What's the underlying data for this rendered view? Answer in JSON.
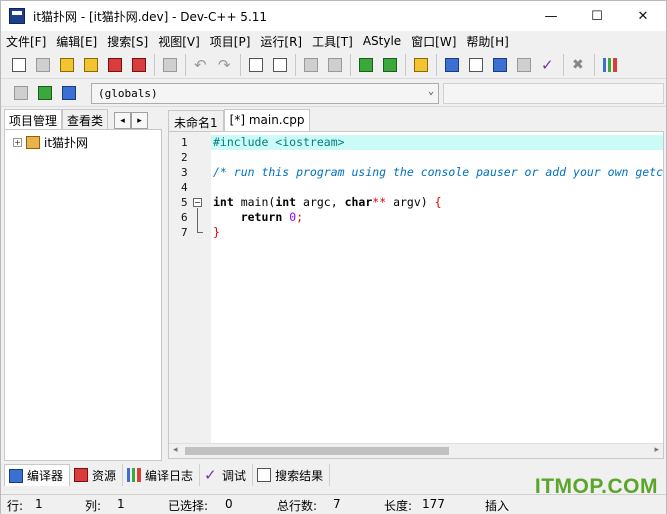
{
  "window": {
    "title": "it猫扑网 - [it猫扑网.dev] - Dev-C++ 5.11",
    "minimize": "—",
    "maximize": "☐",
    "close": "✕"
  },
  "menu": [
    "文件[F]",
    "编辑[E]",
    "搜索[S]",
    "视图[V]",
    "项目[P]",
    "运行[R]",
    "工具[T]",
    "AStyle",
    "窗口[W]",
    "帮助[H]"
  ],
  "toolbar2": {
    "scope_value": "(globals)"
  },
  "left_panel": {
    "tabs": [
      "项目管理",
      "查看类"
    ],
    "nav_prev": "◂",
    "nav_next": "▸",
    "tree": [
      {
        "expander": "+",
        "label": "it猫扑网"
      }
    ]
  },
  "editor": {
    "tabs": [
      "未命名1",
      "[*] main.cpp"
    ],
    "line_numbers": [
      "1",
      "2",
      "3",
      "4",
      "5",
      "6",
      "7"
    ],
    "lines": {
      "l1": {
        "pp": "#include <iostream>"
      },
      "l3": {
        "cmt": "/* run this program using the console pauser or add your own getch, system(\"pause\") or input loop */"
      },
      "l5": {
        "k1": "int",
        "t1": " main(",
        "k2": "int",
        "t2": " argc, ",
        "k3": "char",
        "op": "**",
        "t3": " argv) ",
        "br": "{"
      },
      "l6": {
        "indent": "    ",
        "k1": "return",
        "sp": " ",
        "num": "0",
        "t1": ";"
      },
      "l7": {
        "br": "}"
      }
    },
    "fold_marker": "−"
  },
  "bottom_tabs": [
    {
      "label": "编译器",
      "icon": "compiler-grid-icon"
    },
    {
      "label": "资源",
      "icon": "resources-icon"
    },
    {
      "label": "编译日志",
      "icon": "compile-log-bars-icon"
    },
    {
      "label": "调试",
      "icon": "debug-check-icon"
    },
    {
      "label": "搜索结果",
      "icon": "search-results-icon"
    }
  ],
  "status": {
    "row_label": "行:",
    "row_value": "1",
    "col_label": "列:",
    "col_value": "1",
    "sel_label": "已选择:",
    "sel_value": "0",
    "total_label": "总行数:",
    "total_value": "7",
    "len_label": "长度:",
    "len_value": "177",
    "mode": "插入"
  },
  "watermark": "ITMOP.COM"
}
